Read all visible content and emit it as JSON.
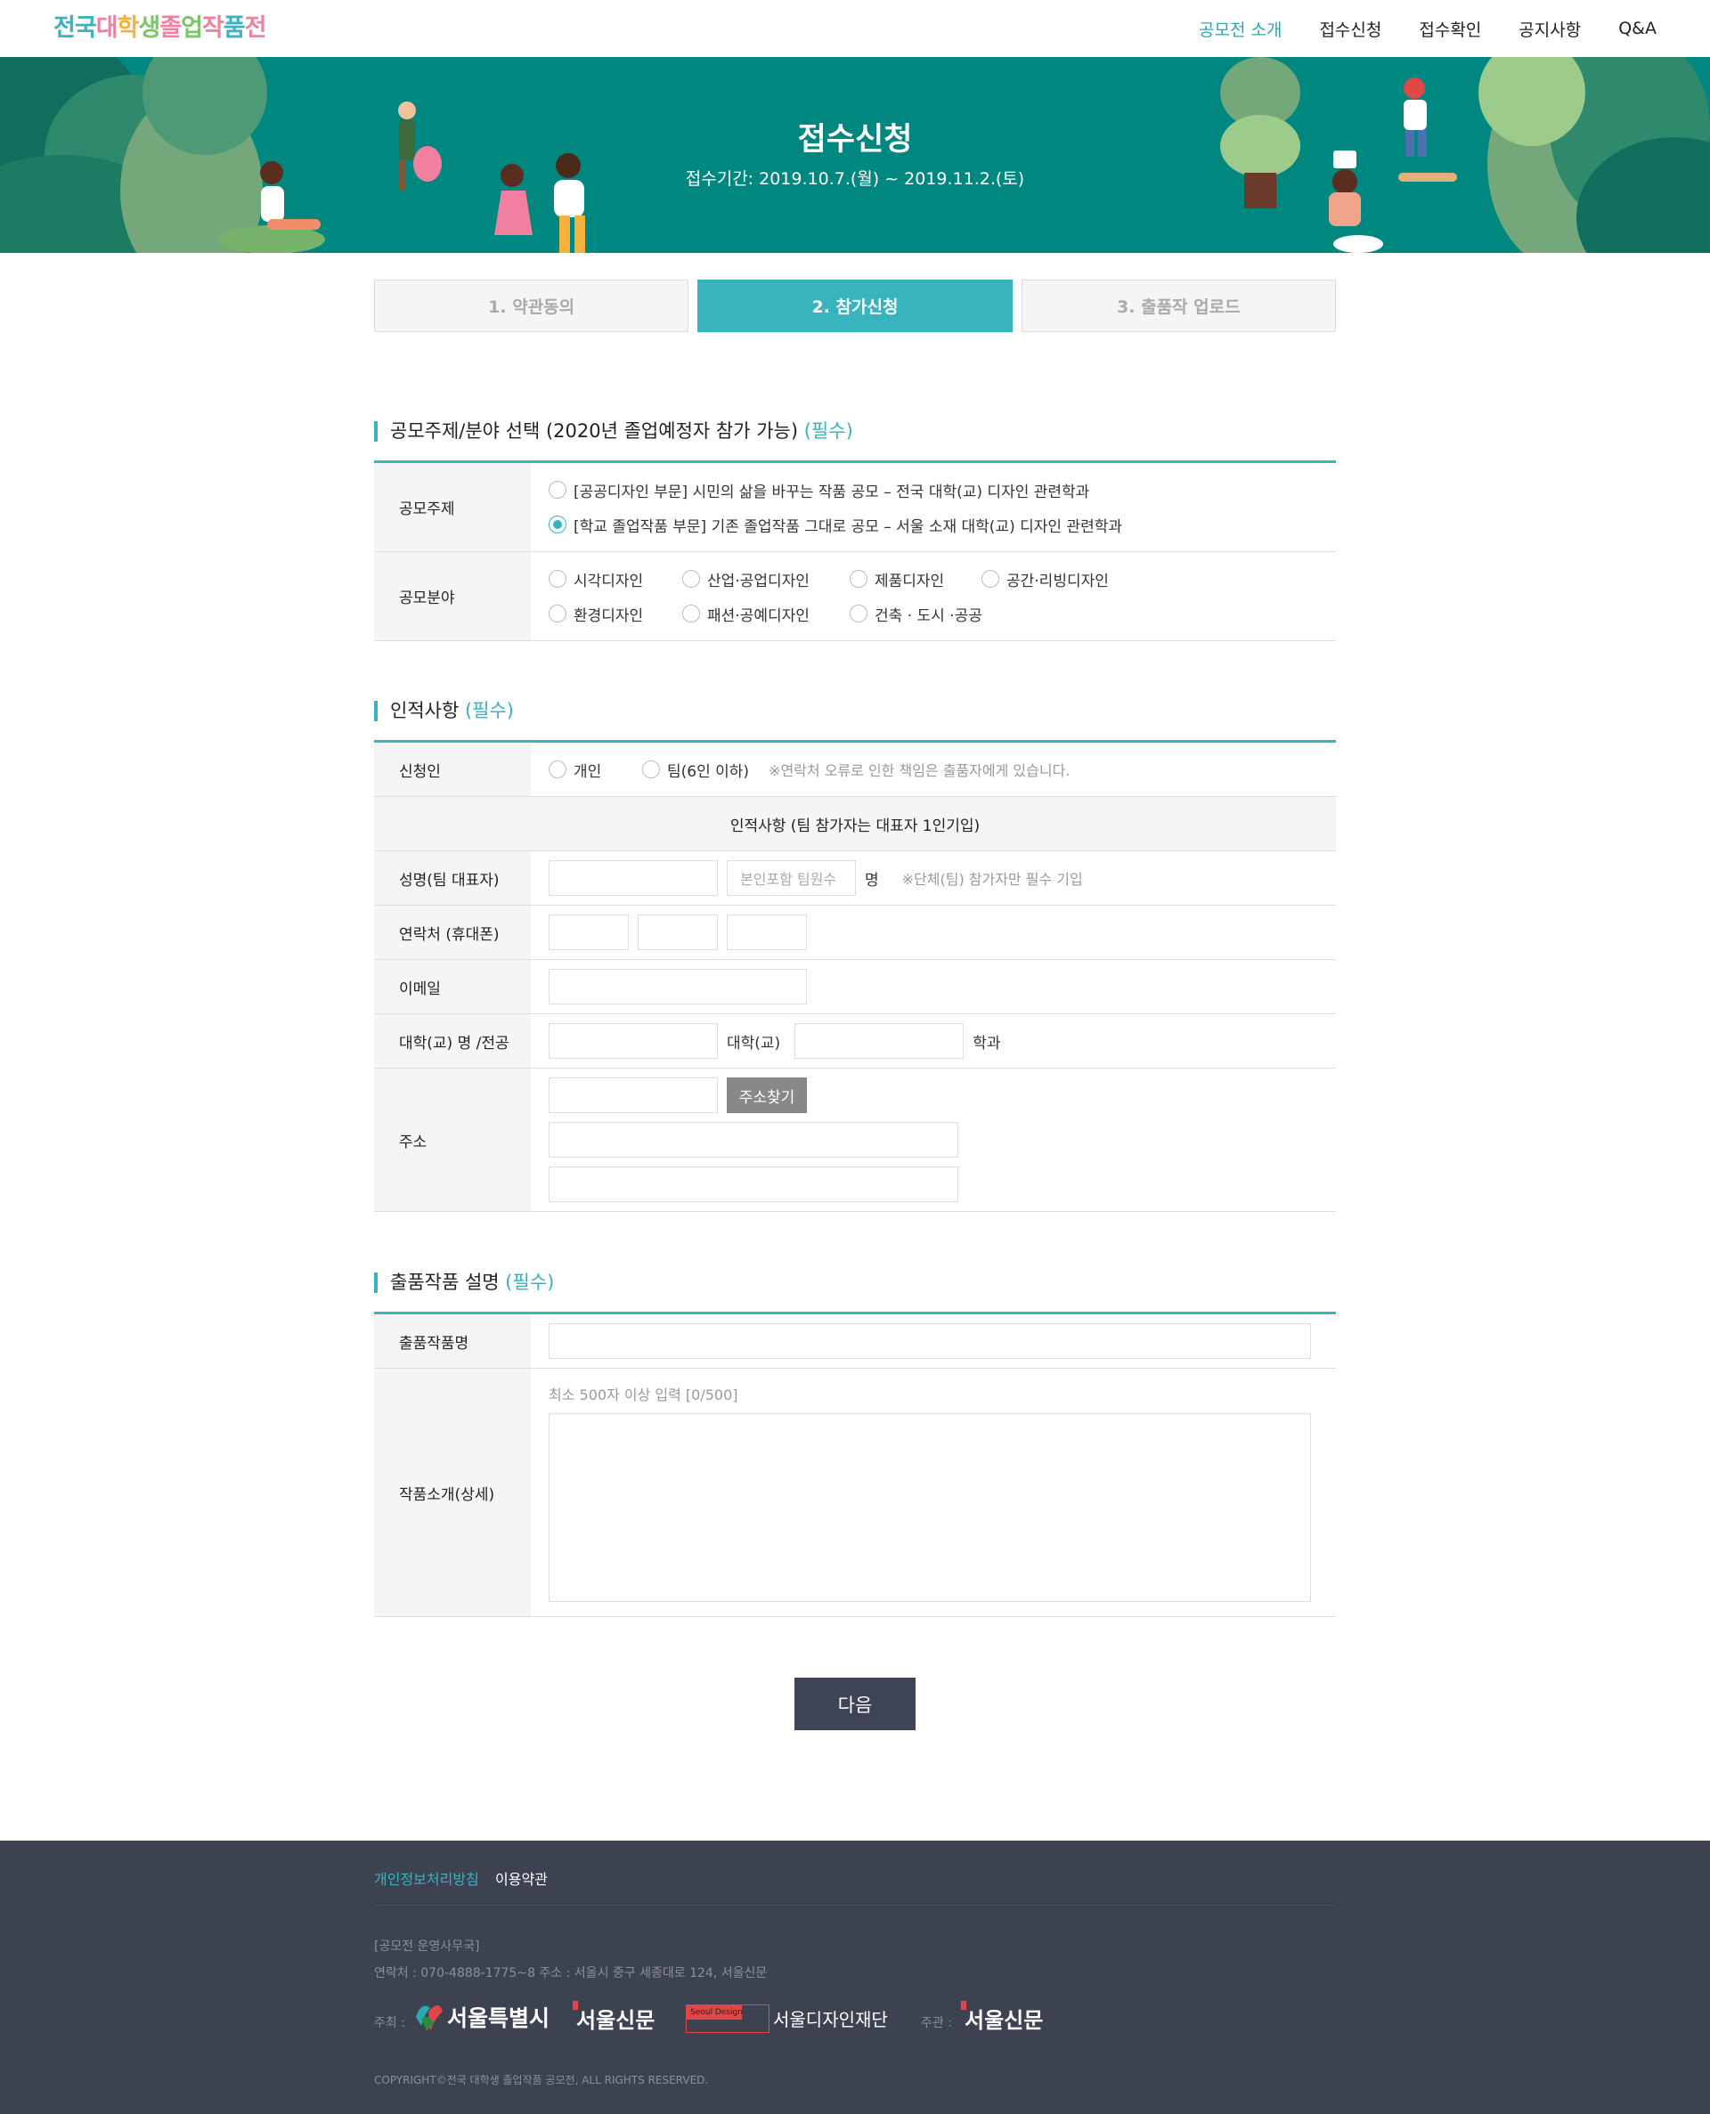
{
  "header": {
    "logo": [
      "전",
      "국",
      "대",
      "학",
      "생",
      "졸",
      "업",
      "작",
      "품",
      "전"
    ],
    "logo_colors": [
      "#37b4bd",
      "#37b4bd",
      "#f07fa0",
      "#f5b13a",
      "#7cc36a",
      "#f07fa0",
      "#7cc36a",
      "#f07fa0",
      "#37b4bd",
      "#f07fa0"
    ],
    "nav": [
      "공모전 소개",
      "접수신청",
      "접수확인",
      "공지사항",
      "Q&A"
    ]
  },
  "hero": {
    "title": "접수신청",
    "period": "접수기간: 2019.10.7.(월) ~ 2019.11.2.(토)"
  },
  "steps": [
    "1. 약관동의",
    "2. 참가신청",
    "3. 출품작 업로드"
  ],
  "theme_section": {
    "title": "공모주제/분야 선택 (2020년 졸업예정자 참가 가능)",
    "required": "(필수)",
    "theme_label": "공모주제",
    "themes": [
      "[공공디자인 부문] 시민의 삶을 바꾸는 작품 공모 – 전국 대학(교) 디자인 관련학과",
      "[학교 졸업작품 부문] 기존 졸업작품 그대로 공모 – 서울 소재 대학(교) 디자인 관련학과"
    ],
    "field_label": "공모분야",
    "fields_row1": [
      "시각디자인",
      "산업·공업디자인",
      "제품디자인",
      "공간·리빙디자인"
    ],
    "fields_row2": [
      "환경디자인",
      "패션·공예디자인",
      "건축 · 도시 ·공공"
    ]
  },
  "personal_section": {
    "title": "인적사항",
    "required": "(필수)",
    "applicant_label": "신청인",
    "applicant_options": [
      "개인",
      "팀(6인 이하)"
    ],
    "applicant_note": "※연락처 오류로 인한 책임은 출품자에게 있습니다.",
    "info_header": "인적사항 (팀 참가자는 대표자 1인기입)",
    "name_label": "성명(팀 대표자)",
    "team_count_placeholder": "본인포함 팀원수",
    "team_unit": "명",
    "team_note": "※단체(팀) 참가자만 필수 기입",
    "phone_label": "연락처 (휴대폰)",
    "email_label": "이메일",
    "school_label": "대학(교) 명 /전공",
    "school_unit": "대학(교)",
    "major_unit": "학과",
    "address_label": "주소",
    "address_button": "주소찾기"
  },
  "work_section": {
    "title": "출품작품 설명",
    "required": "(필수)",
    "name_label": "출품작품명",
    "desc_label": "작품소개(상세)",
    "desc_hint": "최소 500자 이상 입력 [0/500]"
  },
  "next_button": "다음",
  "footer": {
    "privacy": "개인정보처리방침",
    "terms": "이용약관",
    "office": "[공모전 운영사무국]",
    "contact": "연락처 : 070-4888-1775~8     주소 : 서울시 중구 세종대로 124, 서울신문",
    "host_label": "주최 :",
    "hosts": [
      "서울특별시",
      "서울신문",
      "서울디자인재단"
    ],
    "seoul_design_badge": "Seoul Design",
    "organizer_label": "주관 :",
    "organizer": "서울신문",
    "copyright": "COPYRIGHT©전국 대학생 졸업작품 공모전, ALL RIGHTS RESERVED."
  }
}
